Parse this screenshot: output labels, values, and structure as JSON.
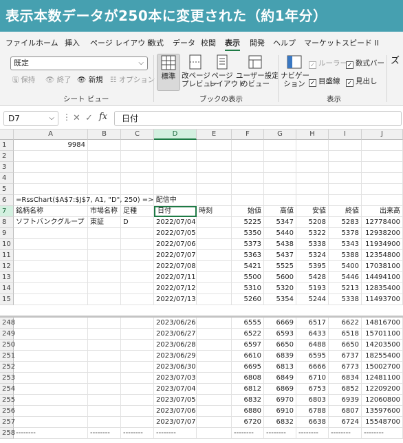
{
  "banner": {
    "title": "表示本数データが250本に変更された（約1年分）"
  },
  "menu": {
    "tabs": [
      "ファイル",
      "ホーム",
      "挿入",
      "ページ レイアウト",
      "数式",
      "データ",
      "校閲",
      "表示",
      "開発",
      "ヘルプ",
      "マーケットスピード II"
    ],
    "active": "表示"
  },
  "ribbon": {
    "sheet_view": {
      "select_value": "既定",
      "keep": "保持",
      "exit": "終了",
      "new": "新規",
      "options": "オプション",
      "label": "シート ビュー"
    },
    "book_view": {
      "normal": "標準",
      "page_break": "改ページ\nプレビュー",
      "page_layout": "ページ\nレイアウト",
      "custom": "ユーザー設定\nのビュー",
      "label": "ブックの表示"
    },
    "show": {
      "navigation": "ナビゲー\nション",
      "ruler": "ルーラー",
      "formula_bar": "数式バー",
      "gridlines": "目盛線",
      "headings": "見出し",
      "label": "表示"
    },
    "zoom_partial": "ズ"
  },
  "formula_bar": {
    "name_box": "D7",
    "cancel": "✕",
    "enter": "✓",
    "fx": "fx",
    "value": "日付"
  },
  "sheet": {
    "columns": [
      "A",
      "B",
      "C",
      "D",
      "E",
      "F",
      "G",
      "H",
      "I",
      "J"
    ],
    "selected_column": "D",
    "selected_row": "7",
    "a1_value": "9984",
    "formula_row_text": "=RssChart($A$7:$J$7, A1, \"D\", 250) => 配信中",
    "headers": [
      "銘柄名称",
      "市場名称",
      "足種",
      "日付",
      "時刻",
      "始値",
      "高値",
      "安値",
      "終値",
      "出来高"
    ],
    "top_rows": [
      {
        "row": "8",
        "name": "ソフトバンクグループ",
        "market": "東証",
        "kind": "D",
        "date": "2022/07/04",
        "open": "5225",
        "high": "5347",
        "low": "5208",
        "close": "5283",
        "volume": "12778400"
      },
      {
        "row": "9",
        "date": "2022/07/05",
        "open": "5350",
        "high": "5440",
        "low": "5322",
        "close": "5378",
        "volume": "12938200"
      },
      {
        "row": "10",
        "date": "2022/07/06",
        "open": "5373",
        "high": "5438",
        "low": "5338",
        "close": "5343",
        "volume": "11934900"
      },
      {
        "row": "11",
        "date": "2022/07/07",
        "open": "5363",
        "high": "5437",
        "low": "5324",
        "close": "5388",
        "volume": "12354800"
      },
      {
        "row": "12",
        "date": "2022/07/08",
        "open": "5421",
        "high": "5525",
        "low": "5395",
        "close": "5400",
        "volume": "17038100"
      },
      {
        "row": "13",
        "date": "2022/07/11",
        "open": "5500",
        "high": "5600",
        "low": "5428",
        "close": "5446",
        "volume": "14494100"
      },
      {
        "row": "14",
        "date": "2022/07/12",
        "open": "5310",
        "high": "5320",
        "low": "5193",
        "close": "5213",
        "volume": "12835400"
      },
      {
        "row": "15",
        "date": "2022/07/13",
        "open": "5260",
        "high": "5354",
        "low": "5244",
        "close": "5338",
        "volume": "11493700"
      }
    ],
    "bottom_rows": [
      {
        "row": "248",
        "date": "2023/06/26",
        "open": "6555",
        "high": "6669",
        "low": "6517",
        "close": "6622",
        "volume": "14816700"
      },
      {
        "row": "249",
        "date": "2023/06/27",
        "open": "6522",
        "high": "6593",
        "low": "6433",
        "close": "6518",
        "volume": "15701100"
      },
      {
        "row": "250",
        "date": "2023/06/28",
        "open": "6597",
        "high": "6650",
        "low": "6488",
        "close": "6650",
        "volume": "14203500"
      },
      {
        "row": "251",
        "date": "2023/06/29",
        "open": "6610",
        "high": "6839",
        "low": "6595",
        "close": "6737",
        "volume": "18255400"
      },
      {
        "row": "252",
        "date": "2023/06/30",
        "open": "6695",
        "high": "6813",
        "low": "6666",
        "close": "6773",
        "volume": "15002700"
      },
      {
        "row": "253",
        "date": "2023/07/03",
        "open": "6808",
        "high": "6849",
        "low": "6710",
        "close": "6834",
        "volume": "12481100"
      },
      {
        "row": "254",
        "date": "2023/07/04",
        "open": "6812",
        "high": "6869",
        "low": "6753",
        "close": "6852",
        "volume": "12209200"
      },
      {
        "row": "255",
        "date": "2023/07/05",
        "open": "6832",
        "high": "6970",
        "low": "6803",
        "close": "6939",
        "volume": "12060800"
      },
      {
        "row": "256",
        "date": "2023/07/06",
        "open": "6880",
        "high": "6910",
        "low": "6788",
        "close": "6807",
        "volume": "13597600"
      },
      {
        "row": "257",
        "date": "2023/07/07",
        "open": "6720",
        "high": "6832",
        "low": "6638",
        "close": "6724",
        "volume": "15548700"
      }
    ],
    "end_row": {
      "row": "258",
      "marker": "--------"
    }
  },
  "colors": {
    "banner": "#46a0b0",
    "accent": "#1e7a45",
    "selected_header": "#d3f0e0"
  }
}
